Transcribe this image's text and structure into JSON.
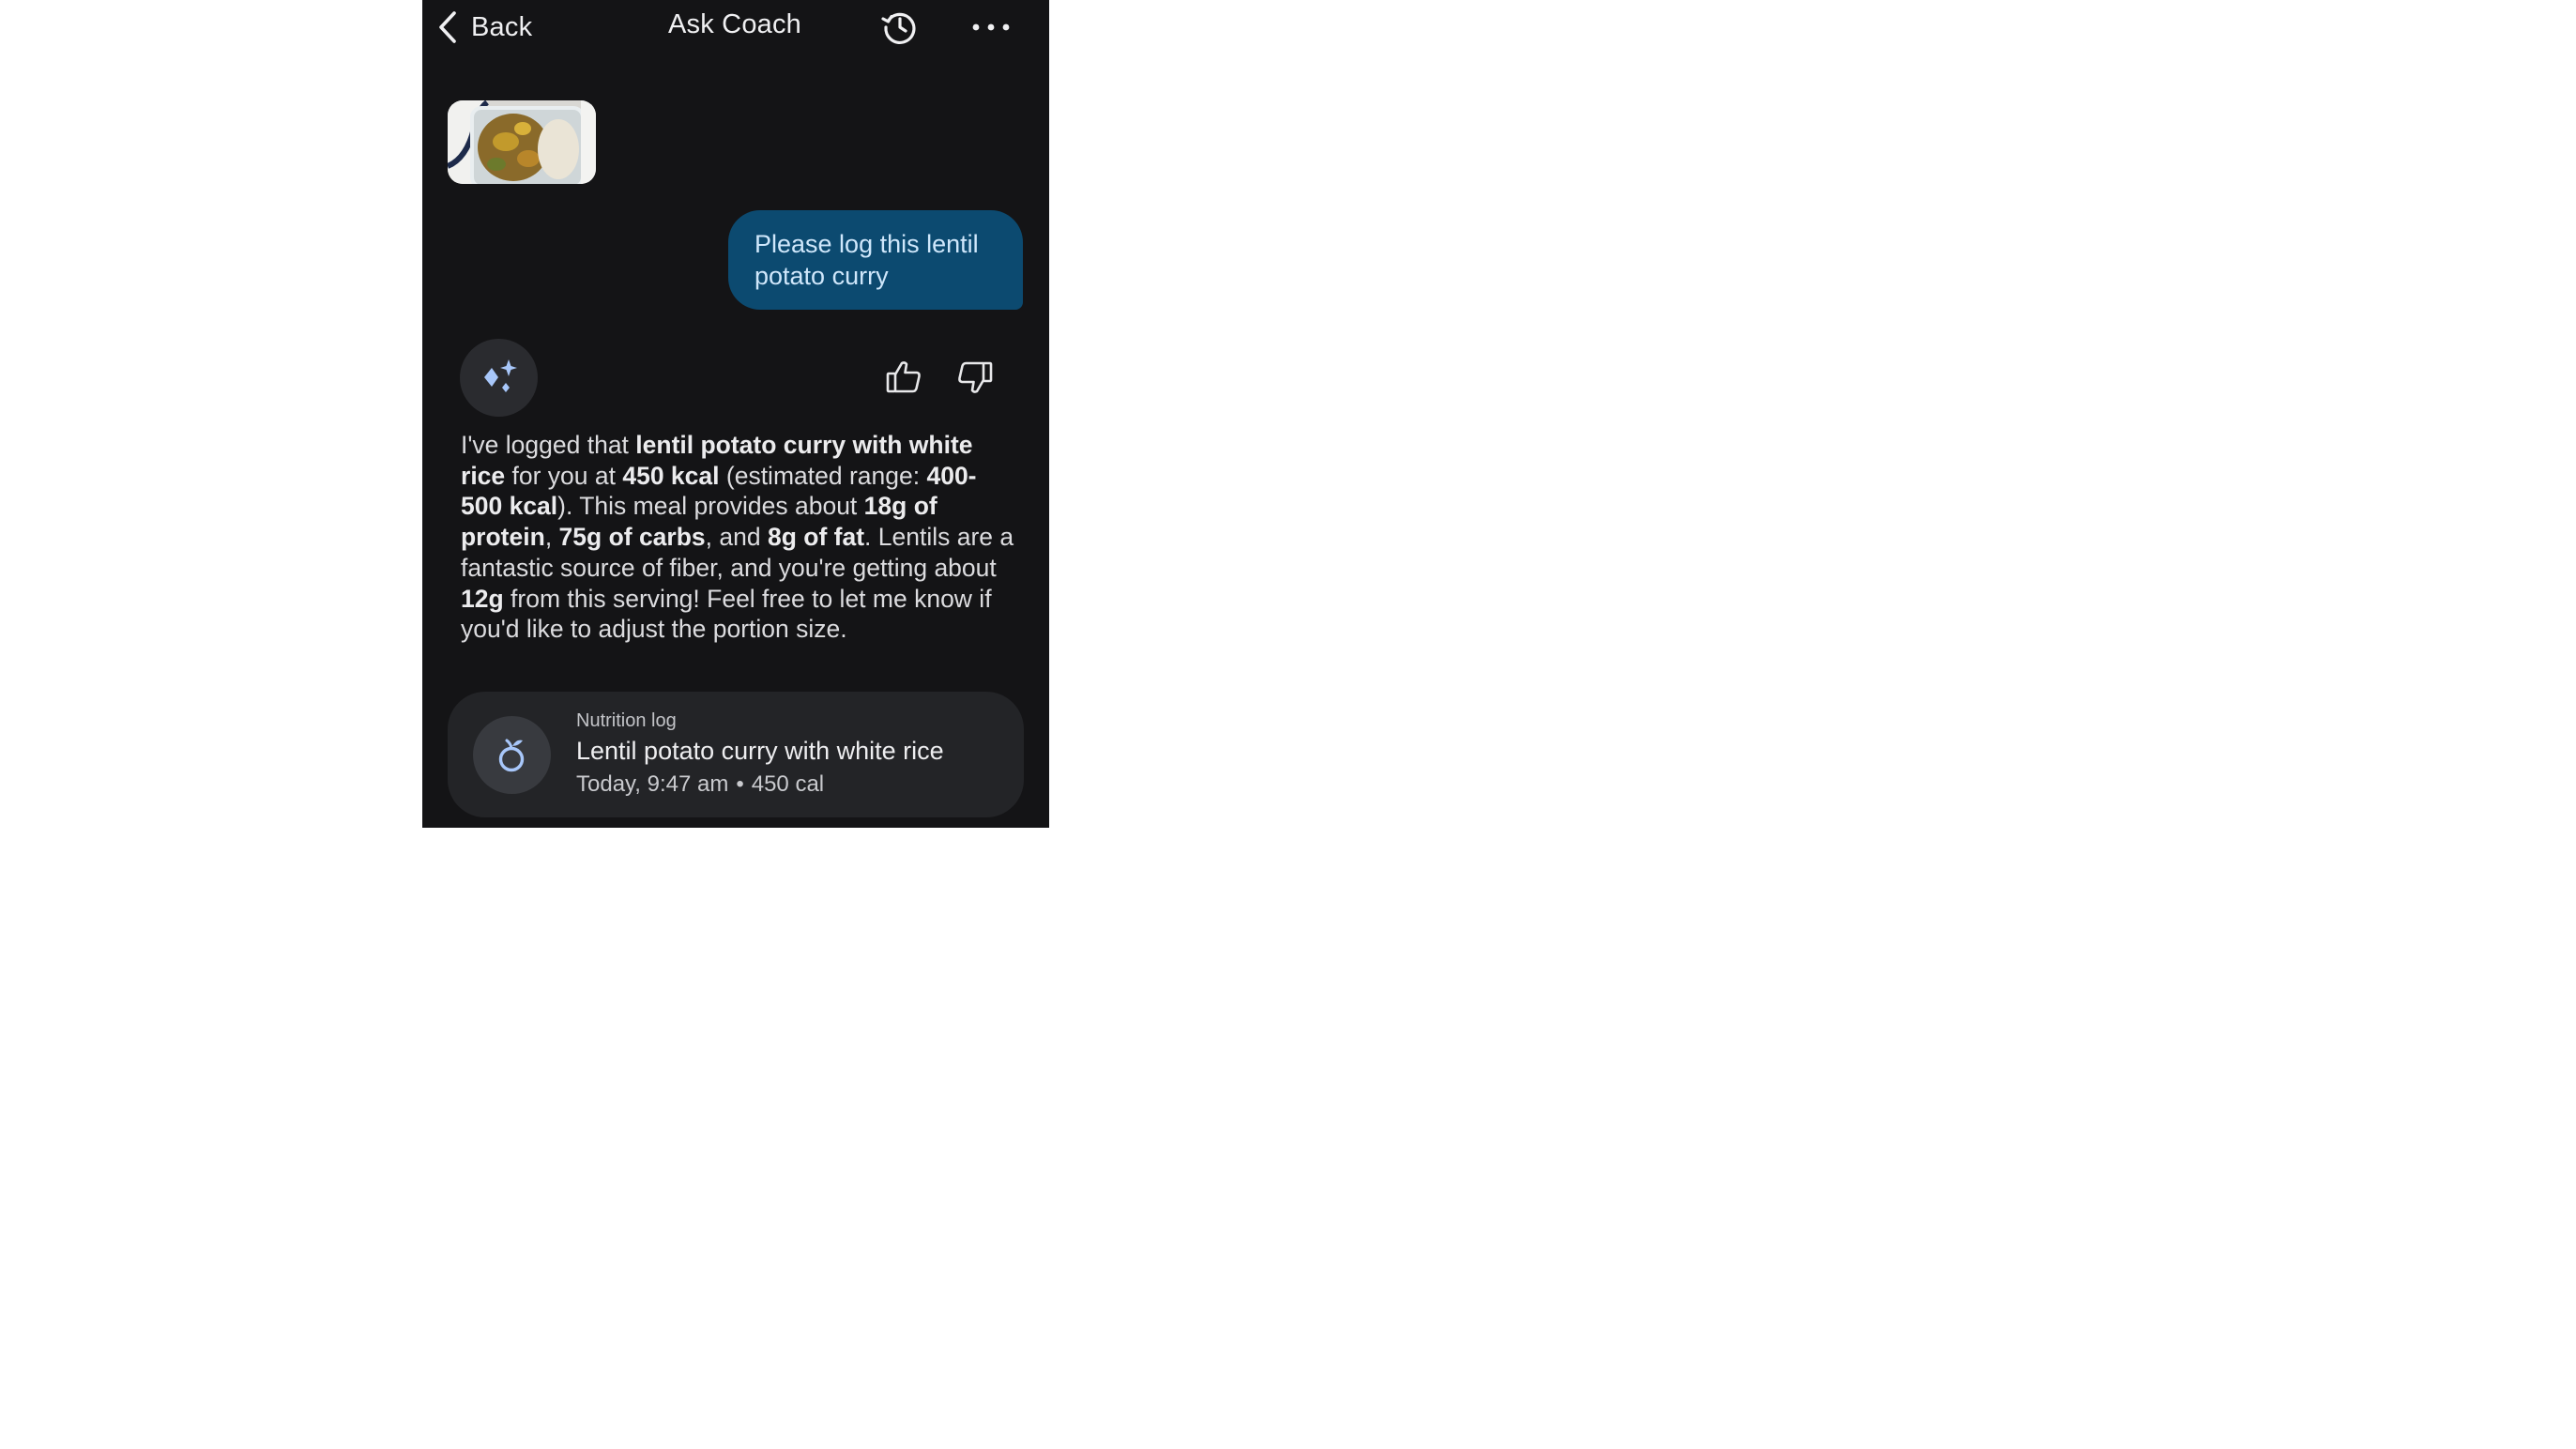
{
  "header": {
    "back_label": "Back",
    "title": "Ask Coach",
    "history_icon": "history-icon",
    "more_icon": "more-horizontal-icon"
  },
  "chat": {
    "user_image": "lentil-potato-curry-photo",
    "user_message": "Please log this lentil potato curry",
    "coach_icon": "sparkle-icon",
    "feedback": {
      "like_icon": "thumbs-up-icon",
      "dislike_icon": "thumbs-down-icon"
    },
    "response_parts": [
      {
        "text": "I've logged that ",
        "bold": false
      },
      {
        "text": "lentil potato curry with white rice",
        "bold": true
      },
      {
        "text": " for you at ",
        "bold": false
      },
      {
        "text": "450 kcal",
        "bold": true
      },
      {
        "text": " (estimated range: ",
        "bold": false
      },
      {
        "text": "400-500 kcal",
        "bold": true
      },
      {
        "text": "). This meal provides about ",
        "bold": false
      },
      {
        "text": "18g of protein",
        "bold": true
      },
      {
        "text": ", ",
        "bold": false
      },
      {
        "text": "75g of carbs",
        "bold": true
      },
      {
        "text": ", and ",
        "bold": false
      },
      {
        "text": "8g of fat",
        "bold": true
      },
      {
        "text": ". Lentils are a fantastic source of fiber, and you're getting about ",
        "bold": false
      },
      {
        "text": "12g",
        "bold": true
      },
      {
        "text": " from this serving! Feel free to let me know if you'd like to adjust the portion size.",
        "bold": false
      }
    ]
  },
  "nutrition_log": {
    "kicker": "Nutrition log",
    "title": "Lentil potato curry with white rice",
    "time": "Today, 9:47 am",
    "separator": "•",
    "calories": "450 cal",
    "icon": "apple-icon"
  },
  "colors": {
    "background": "#141416",
    "user_bubble": "#0c4a70",
    "user_text": "#cfe7fb",
    "accent": "#8ab4f8",
    "card": "#232427"
  }
}
